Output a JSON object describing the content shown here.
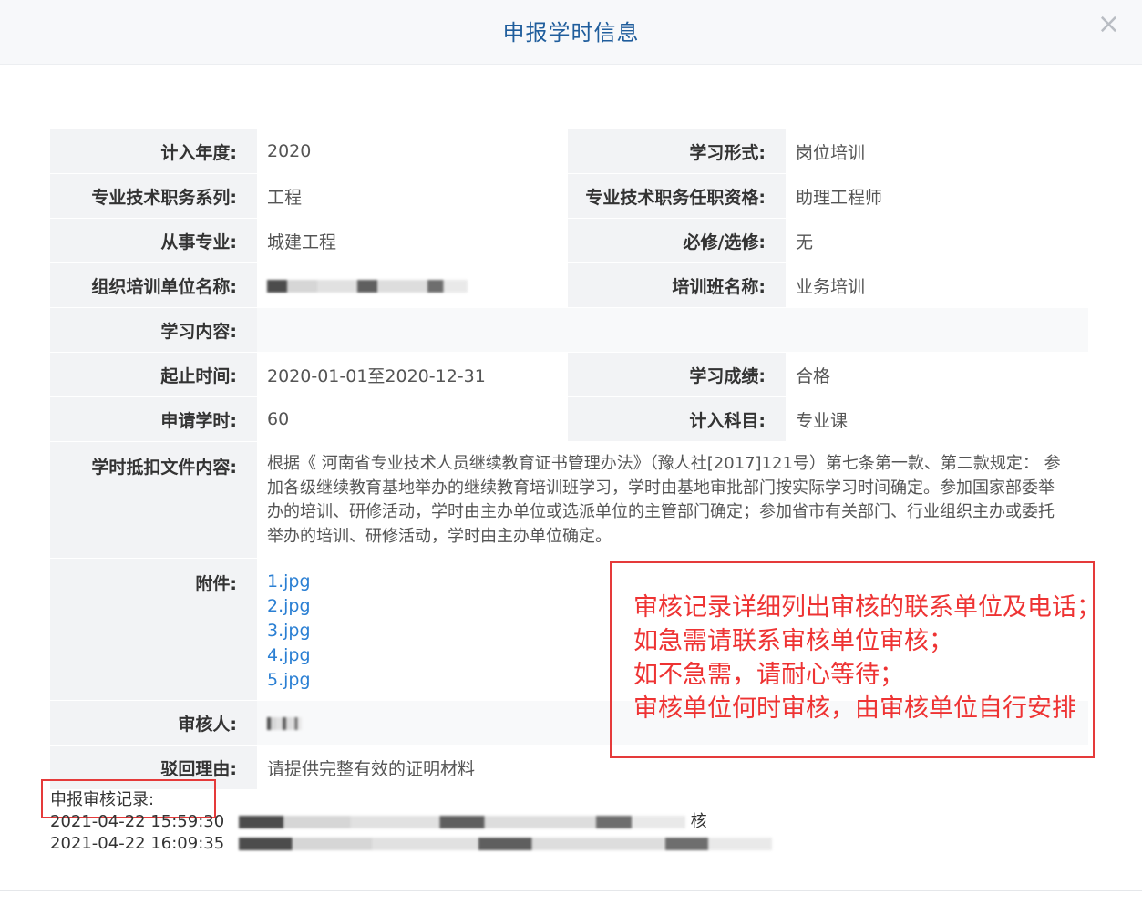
{
  "header": {
    "title": "申报学时信息",
    "close": "×"
  },
  "rows": [
    {
      "l1": "计入年度:",
      "v1": "2020",
      "l2": "学习形式:",
      "v2": "岗位培训"
    },
    {
      "l1": "专业技术职务系列:",
      "v1": "工程",
      "l2": "专业技术职务任职资格:",
      "v2": "助理工程师"
    },
    {
      "l1": "从事专业:",
      "v1": "城建工程",
      "l2": "必修/选修:",
      "v2": "无"
    },
    {
      "l1": "组织培训单位名称:",
      "v1": "",
      "l2": "培训班名称:",
      "v2": "业务培训"
    },
    {
      "l1": "学习内容:",
      "v1": ""
    },
    {
      "l1": "起止时间:",
      "v1": "2020-01-01至2020-12-31",
      "l2": "学习成绩:",
      "v2": "合格"
    },
    {
      "l1": "申请学时:",
      "v1": "60",
      "l2": "计入科目:",
      "v2": "专业课"
    }
  ],
  "deduction": {
    "label": "学时抵扣文件内容:",
    "text": "根据《 河南省专业技术人员继续教育证书管理办法》（豫人社[2017]121号）第七条第一款、第二款规定： 参加各级继续教育基地举办的继续教育培训班学习，学时由基地审批部门按实际学习时间确定。参加国家部委举办的培训、研修活动，学时由主办单位或选派单位的主管部门确定；参加省市有关部门、行业组织主办或委托举办的培训、研修活动，学时由主办单位确定。"
  },
  "attachments": {
    "label": "附件:",
    "files": [
      "1.jpg",
      "2.jpg",
      "3.jpg",
      "4.jpg",
      "5.jpg"
    ]
  },
  "reviewer": {
    "label": "审核人:",
    "value": ""
  },
  "reject": {
    "label": "驳回理由:",
    "value": "请提供完整有效的证明材料"
  },
  "annotation": {
    "lines": [
      "审核记录详细列出审核的联系单位及电话；",
      "如急需请联系审核单位审核；",
      "如不急需，请耐心等待；",
      "审核单位何时审核，由审核单位自行安排"
    ]
  },
  "records": {
    "title": "申报审核记录:",
    "entries": [
      {
        "time": "2021-04-22 15:59:30",
        "tail": "核"
      },
      {
        "time": "2021-04-22 16:09:35",
        "tail": ""
      }
    ]
  },
  "colors": {
    "title": "#1f5d9c",
    "link": "#2a7fd3",
    "annotation": "#ee3333"
  }
}
